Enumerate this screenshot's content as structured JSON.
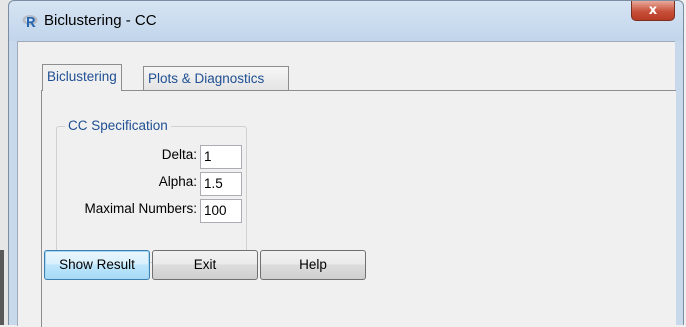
{
  "window": {
    "title": "Biclustering - CC",
    "close_label": "x"
  },
  "tabs": [
    {
      "label": "Biclustering"
    },
    {
      "label": "Plots & Diagnostics"
    }
  ],
  "cc_spec": {
    "title": "CC Specification",
    "fields": [
      {
        "label": "Delta:",
        "value": "1"
      },
      {
        "label": "Alpha:",
        "value": "1.5"
      },
      {
        "label": "Maximal Numbers:",
        "value": "100"
      }
    ]
  },
  "buttons": {
    "show_result": "Show Result",
    "exit": "Exit",
    "help": "Help"
  },
  "colors": {
    "accent_text": "#1f4f93",
    "close_button": "#c7503a",
    "title_bar": "#c8d9ec"
  },
  "icons": {
    "app": "r-logo-icon"
  }
}
